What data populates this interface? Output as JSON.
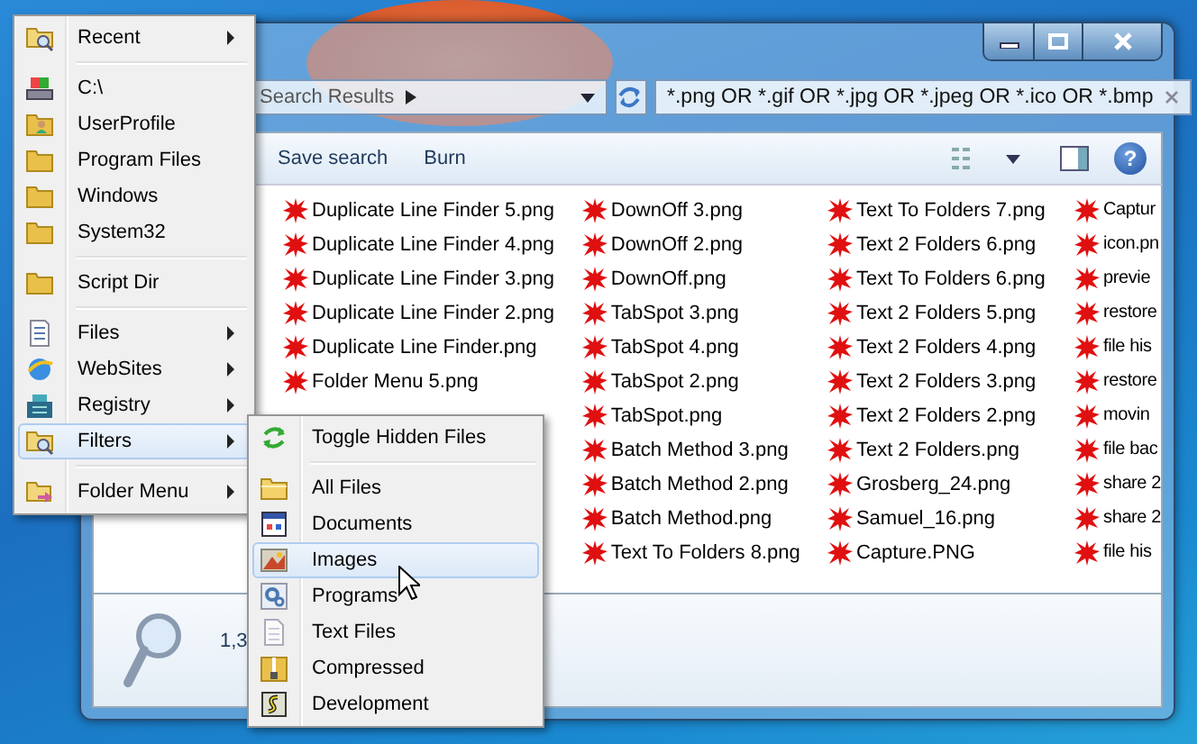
{
  "window": {
    "address": {
      "path": "Search Results"
    },
    "search": {
      "value": "*.png OR *.gif OR *.jpg OR *.jpeg OR *.ico OR *.bmp"
    },
    "toolbar": [
      "Save search",
      "Burn"
    ],
    "files": [
      [
        "Duplicate Line Finder 5.png",
        "Duplicate Line Finder 4.png",
        "Duplicate Line Finder 3.png",
        "Duplicate Line Finder 2.png",
        "Duplicate Line Finder.png",
        "Folder Menu 5.png"
      ],
      [
        "DownOff 3.png",
        "DownOff 2.png",
        "DownOff.png",
        "TabSpot 3.png",
        "TabSpot 4.png",
        "TabSpot 2.png",
        "TabSpot.png",
        "Batch Method 3.png",
        "Batch Method 2.png",
        "Batch Method.png",
        "Text To Folders 8.png"
      ],
      [
        "Text To Folders 7.png",
        "Text 2 Folders 6.png",
        "Text To Folders 6.png",
        "Text 2 Folders 5.png",
        "Text 2 Folders 4.png",
        "Text 2 Folders 3.png",
        "Text 2 Folders 2.png",
        "Text 2 Folders.png",
        "Grosberg_24.png",
        "Samuel_16.png",
        "Capture.PNG"
      ],
      [
        "Captur",
        "icon.pn",
        "previe",
        "restore",
        "file his",
        "restore",
        "movin",
        "file bac",
        "share 2",
        "share 2",
        "file his"
      ]
    ],
    "help": "?",
    "status": "1,3"
  },
  "menu": {
    "sections": [
      [
        {
          "label": "Recent",
          "kind": "search-folder",
          "submenu": true,
          "selected": false
        }
      ],
      [
        {
          "label": "C:\\",
          "kind": "drive",
          "submenu": false,
          "selected": false
        },
        {
          "label": "UserProfile",
          "kind": "user-folder",
          "submenu": false,
          "selected": false
        },
        {
          "label": "Program Files",
          "kind": "folder",
          "submenu": false,
          "selected": false
        },
        {
          "label": "Windows",
          "kind": "folder",
          "submenu": false,
          "selected": false
        },
        {
          "label": "System32",
          "kind": "folder",
          "submenu": false,
          "selected": false
        }
      ],
      [
        {
          "label": "Script Dir",
          "kind": "folder",
          "submenu": false,
          "selected": false
        }
      ],
      [
        {
          "label": "Files",
          "kind": "document",
          "submenu": true,
          "selected": false
        },
        {
          "label": "WebSites",
          "kind": "globe",
          "submenu": true,
          "selected": false
        },
        {
          "label": "Registry",
          "kind": "registry",
          "submenu": true,
          "selected": false
        },
        {
          "label": "Filters",
          "kind": "search-folder",
          "submenu": true,
          "selected": true
        }
      ],
      [
        {
          "label": "Folder Menu",
          "kind": "folder-arrow",
          "submenu": true,
          "selected": false
        }
      ]
    ]
  },
  "submenu": {
    "sections": [
      [
        {
          "label": "Toggle Hidden Files",
          "kind": "arrows",
          "selected": false
        }
      ],
      [
        {
          "label": "All Files",
          "kind": "open-folder",
          "selected": false
        },
        {
          "label": "Documents",
          "kind": "window",
          "selected": false
        },
        {
          "label": "Images",
          "kind": "image",
          "selected": true
        },
        {
          "label": "Programs",
          "kind": "gear",
          "selected": false
        },
        {
          "label": "Text Files",
          "kind": "page",
          "selected": false
        },
        {
          "label": "Compressed",
          "kind": "zip",
          "selected": false
        },
        {
          "label": "Development",
          "kind": "script",
          "selected": false
        }
      ]
    ]
  }
}
